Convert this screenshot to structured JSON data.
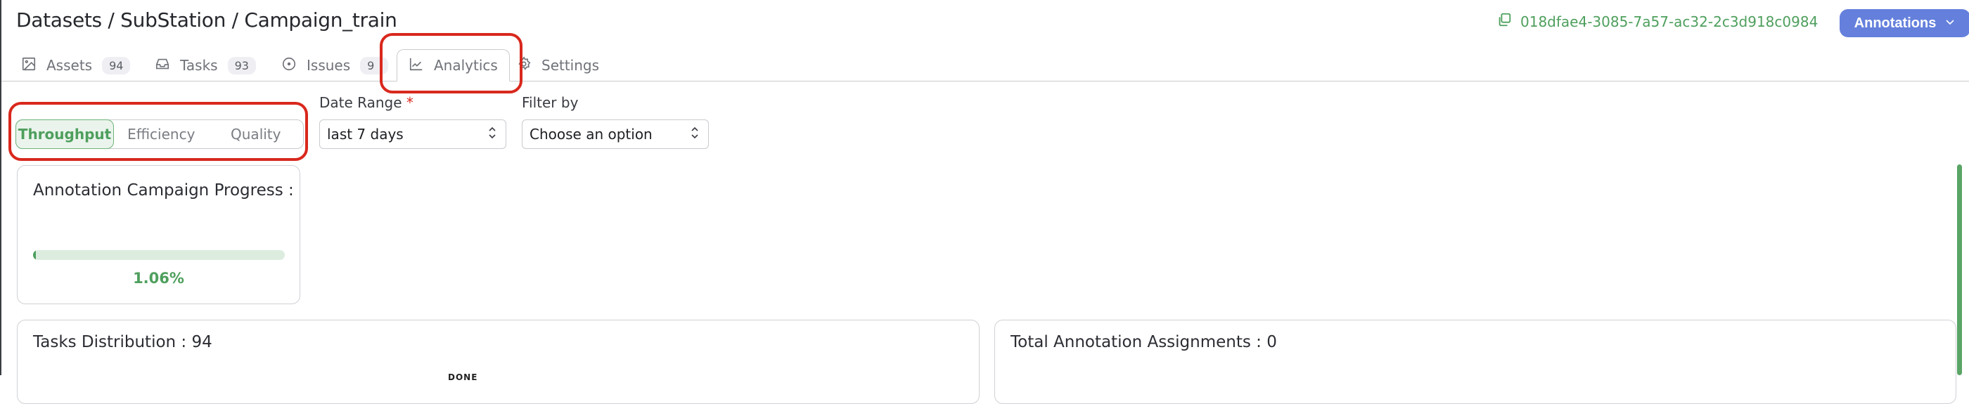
{
  "header": {
    "breadcrumb": "Datasets / SubStation / Campaign_train",
    "dataset_id": "018dfae4-3085-7a57-ac32-2c3d918c0984",
    "annotations_button": "Annotations"
  },
  "tabs": [
    {
      "label": "Assets",
      "badge": "94",
      "icon": "image-icon"
    },
    {
      "label": "Tasks",
      "badge": "93",
      "icon": "inbox-icon"
    },
    {
      "label": "Issues",
      "badge": "9",
      "icon": "issue-circle-icon"
    },
    {
      "label": "Analytics",
      "icon": "chart-line-icon",
      "active": true
    },
    {
      "label": "Settings",
      "icon": "gear-icon"
    }
  ],
  "metric_tabs": {
    "items": [
      "Throughput",
      "Efficiency",
      "Quality"
    ],
    "selected": "Throughput"
  },
  "filters": {
    "date_range": {
      "label": "Date Range",
      "required_mark": "*",
      "value": "last 7 days"
    },
    "filter_by": {
      "label": "Filter by",
      "value": "Choose an option"
    }
  },
  "progress_card": {
    "title": "Annotation Campaign Progress :",
    "percent_text": "1.06%",
    "percent_value": 1.06
  },
  "tasks_distribution": {
    "title": "Tasks Distribution : 94",
    "clipped_label": "DONE"
  },
  "assignments": {
    "title": "Total Annotation Assignments : 0"
  },
  "colors": {
    "accent_green": "#4e9f5d",
    "button_blue": "#6480dc",
    "annotation_red": "#d9281d"
  }
}
